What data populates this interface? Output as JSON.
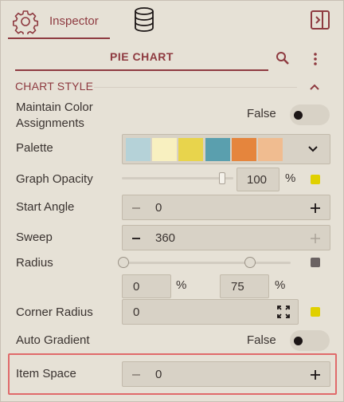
{
  "tabs": {
    "inspector_label": "Inspector",
    "inspector_icon": "gear-icon",
    "data_icon": "database-icon",
    "collapse_icon": "panel-collapse-icon"
  },
  "header": {
    "title": "PIE CHART",
    "search_icon": "search-icon",
    "more_icon": "more-vertical-icon"
  },
  "section": {
    "title": "CHART STYLE",
    "expanded": true
  },
  "props": {
    "maintain_color": {
      "label_line1": "Maintain Color",
      "label_line2": "Assignments",
      "value": "False"
    },
    "palette": {
      "label": "Palette",
      "colors": [
        "#b5d2d8",
        "#f8f0c0",
        "#e8d44c",
        "#5a9fae",
        "#e5853d",
        "#f0bc90"
      ]
    },
    "graph_opacity": {
      "label": "Graph Opacity",
      "value": "100",
      "unit": "%",
      "level": 0.9,
      "color": "#e0d000"
    },
    "start_angle": {
      "label": "Start Angle",
      "value": "0"
    },
    "sweep": {
      "label": "Sweep",
      "value": "360"
    },
    "radius": {
      "label": "Radius",
      "min": "0",
      "max": "75",
      "unit": "%",
      "color": "#6a6262"
    },
    "corner_radius": {
      "label": "Corner Radius",
      "value": "0",
      "color": "#e0d000"
    },
    "auto_gradient": {
      "label": "Auto Gradient",
      "value": "False"
    },
    "item_space": {
      "label": "Item Space",
      "value": "0"
    }
  },
  "colors": {
    "accent": "#8e3a40",
    "background": "#e6e1d6",
    "highlight": "#e06a6a"
  }
}
